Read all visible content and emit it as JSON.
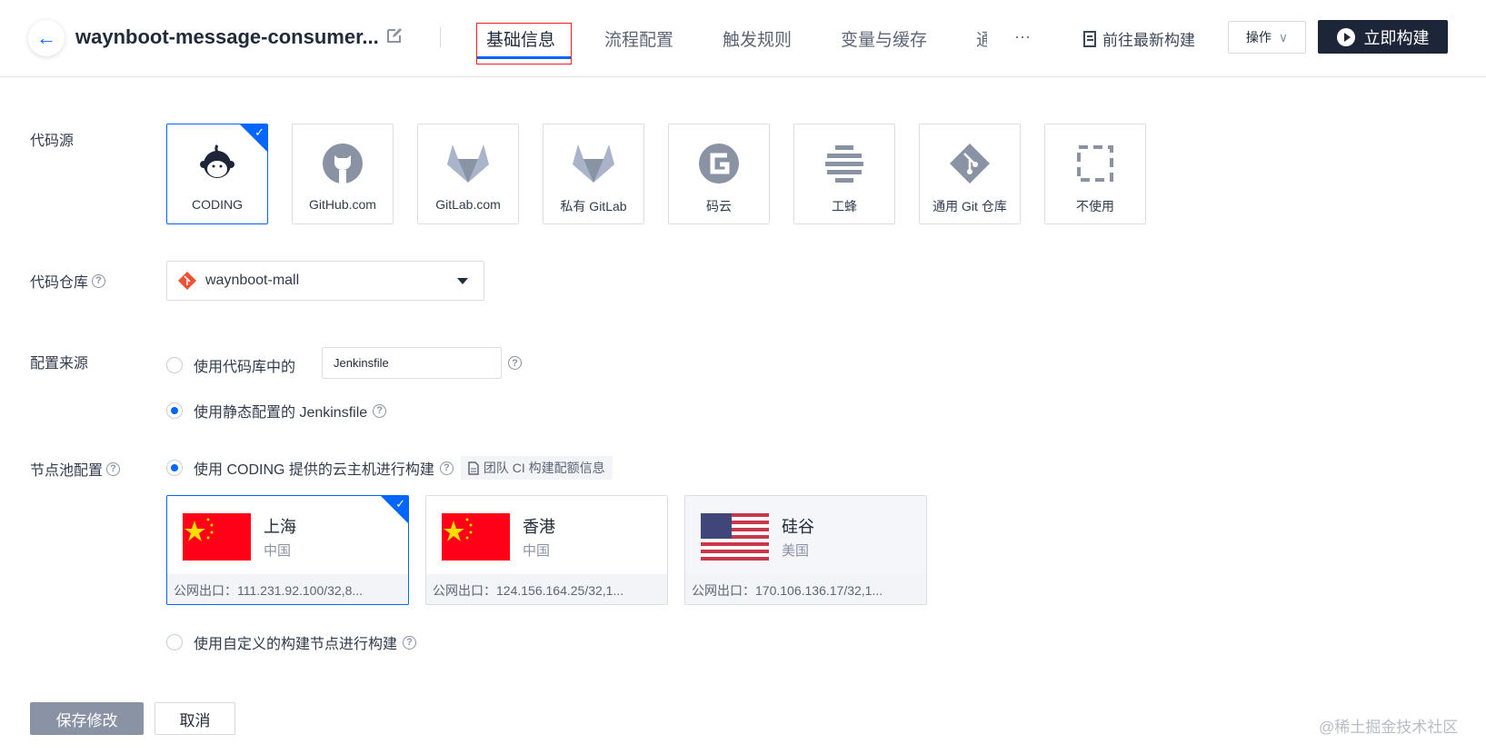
{
  "header": {
    "title": "waynboot-message-consumer...",
    "tabs": [
      "基础信息",
      "流程配置",
      "触发规则",
      "变量与缓存",
      "通"
    ],
    "more": "···",
    "latest_build": "前往最新构建",
    "ops": "操作",
    "build_now": "立即构建"
  },
  "code_source": {
    "label": "代码源",
    "options": [
      "CODING",
      "GitHub.com",
      "GitLab.com",
      "私有 GitLab",
      "码云",
      "工蜂",
      "通用 Git 仓库",
      "不使用"
    ]
  },
  "repo": {
    "label": "代码仓库",
    "value": "waynboot-mall"
  },
  "config_source": {
    "label": "配置来源",
    "option1": "使用代码库中的",
    "jenkinsfile_value": "Jenkinsfile",
    "option2": "使用静态配置的 Jenkinsfile"
  },
  "node_pool": {
    "label": "节点池配置",
    "option1": "使用 CODING 提供的云主机进行构建",
    "quota_link": "团队 CI 构建配额信息",
    "nodes": [
      {
        "city": "上海",
        "country": "中国",
        "egress": "公网出口：111.231.92.100/32,8..."
      },
      {
        "city": "香港",
        "country": "中国",
        "egress": "公网出口：124.156.164.25/32,1..."
      },
      {
        "city": "硅谷",
        "country": "美国",
        "egress": "公网出口：170.106.136.17/32,1..."
      }
    ],
    "option2": "使用自定义的构建节点进行构建"
  },
  "footer": {
    "save": "保存修改",
    "cancel": "取消"
  },
  "watermark": "@稀土掘金技术社区",
  "colors": {
    "accent": "#0066ff",
    "dark_button": "#1d2638"
  }
}
